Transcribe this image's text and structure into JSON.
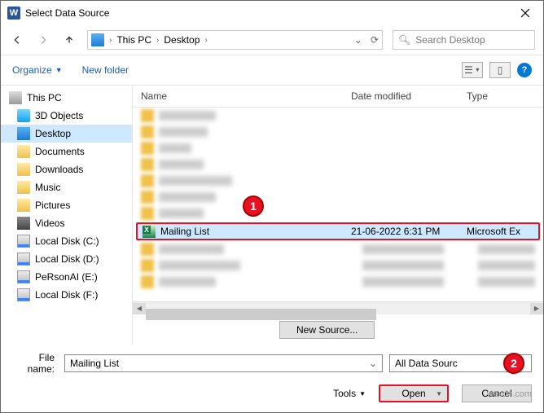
{
  "window": {
    "title": "Select Data Source"
  },
  "breadcrumbs": {
    "pc": "This PC",
    "desktop": "Desktop"
  },
  "search": {
    "placeholder": "Search Desktop"
  },
  "toolbar": {
    "organize": "Organize",
    "new_folder": "New folder"
  },
  "sidebar": {
    "this_pc": "This PC",
    "objects_3d": "3D Objects",
    "desktop": "Desktop",
    "documents": "Documents",
    "downloads": "Downloads",
    "music": "Music",
    "pictures": "Pictures",
    "videos": "Videos",
    "disk_c": "Local Disk (C:)",
    "disk_d": "Local Disk (D:)",
    "personal_e": "PeRsonAI (E:)",
    "disk_f": "Local Disk (F:)"
  },
  "columns": {
    "name": "Name",
    "date": "Date modified",
    "type": "Type"
  },
  "selected_file": {
    "name": "Mailing List",
    "date": "21-06-2022 6:31 PM",
    "type": "Microsoft Ex"
  },
  "callouts": {
    "one": "1",
    "two": "2"
  },
  "new_source": "New Source...",
  "filename": {
    "label": "File name:",
    "value": "Mailing List"
  },
  "filter": {
    "label": "All Data Sourc"
  },
  "buttons": {
    "tools": "Tools",
    "open": "Open",
    "cancel": "Cancel"
  },
  "watermark": "wsxdn.com"
}
